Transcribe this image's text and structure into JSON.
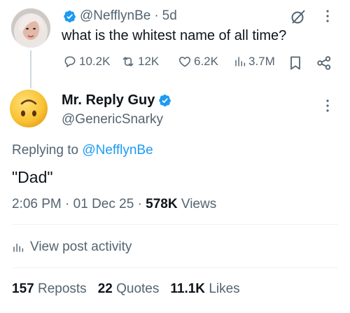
{
  "parent_tweet": {
    "handle": "@NefflynBe",
    "time": "5d",
    "text": "what is the whitest name of all time?",
    "replies": "10.2K",
    "reposts": "12K",
    "likes": "6.2K",
    "views": "3.7M"
  },
  "reply_tweet": {
    "name": "Mr. Reply Guy",
    "handle": "@GenericSnarky",
    "replying_prefix": "Replying to",
    "replying_handle": "@NefflynBe",
    "text": "\"Dad\"",
    "time": "2:06 PM",
    "date": "01 Dec 25",
    "views_count": "578K",
    "views_label": "Views"
  },
  "activity_label": "View post activity",
  "stats": {
    "reposts_count": "157",
    "reposts_label": "Reposts",
    "quotes_count": "22",
    "quotes_label": "Quotes",
    "likes_count": "11.1K",
    "likes_label": "Likes"
  },
  "colors": {
    "accent": "#1d9bf0",
    "secondary_text": "#536471",
    "primary_text": "#0f1419",
    "emoji_yellow": "#f9c232"
  },
  "icons": {
    "verified": "verified-badge-icon",
    "grok": "grok-icon",
    "more": "more-options-icon",
    "reply": "reply-icon",
    "repost": "repost-icon",
    "like": "like-icon",
    "views": "views-icon",
    "bookmark": "bookmark-icon",
    "share": "share-icon",
    "activity": "activity-icon",
    "avatar_emoji": "upside-down-face-icon"
  }
}
